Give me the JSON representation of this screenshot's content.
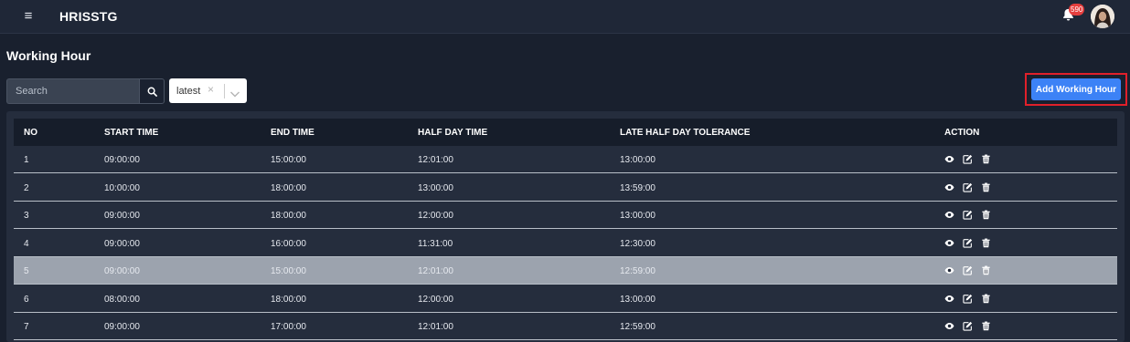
{
  "header": {
    "menu_icon": "hamburger-icon",
    "brand": "HRISSTG",
    "notification_count": "590",
    "bell_icon": "bell-icon"
  },
  "page": {
    "title": "Working Hour"
  },
  "toolbar": {
    "search_placeholder": "Search",
    "search_icon": "search-icon",
    "sort_value": "latest",
    "clear_glyph": "×",
    "add_label": "Add Working Hour"
  },
  "table": {
    "headers": [
      "NO",
      "START TIME",
      "END TIME",
      "HALF DAY TIME",
      "LATE HALF DAY TOLERANCE",
      "ACTION"
    ],
    "rows": [
      {
        "no": "1",
        "start": "09:00:00",
        "end": "15:00:00",
        "half": "12:01:00",
        "late": "13:00:00"
      },
      {
        "no": "2",
        "start": "10:00:00",
        "end": "18:00:00",
        "half": "13:00:00",
        "late": "13:59:00"
      },
      {
        "no": "3",
        "start": "09:00:00",
        "end": "18:00:00",
        "half": "12:00:00",
        "late": "13:00:00"
      },
      {
        "no": "4",
        "start": "09:00:00",
        "end": "16:00:00",
        "half": "11:31:00",
        "late": "12:30:00"
      },
      {
        "no": "5",
        "start": "09:00:00",
        "end": "15:00:00",
        "half": "12:01:00",
        "late": "12:59:00"
      },
      {
        "no": "6",
        "start": "08:00:00",
        "end": "18:00:00",
        "half": "12:00:00",
        "late": "13:00:00"
      },
      {
        "no": "7",
        "start": "09:00:00",
        "end": "17:00:00",
        "half": "12:01:00",
        "late": "12:59:00"
      }
    ],
    "highlighted_row": 4,
    "action_icons": [
      "eye-icon",
      "edit-icon",
      "trash-icon"
    ]
  },
  "colors": {
    "background": "#19202e",
    "topbar": "#1f2737",
    "accent": "#3c82f6",
    "highlight_outline": "#e0202a",
    "badge": "#e53e3e",
    "row_highlight": "#9ca3ae"
  }
}
